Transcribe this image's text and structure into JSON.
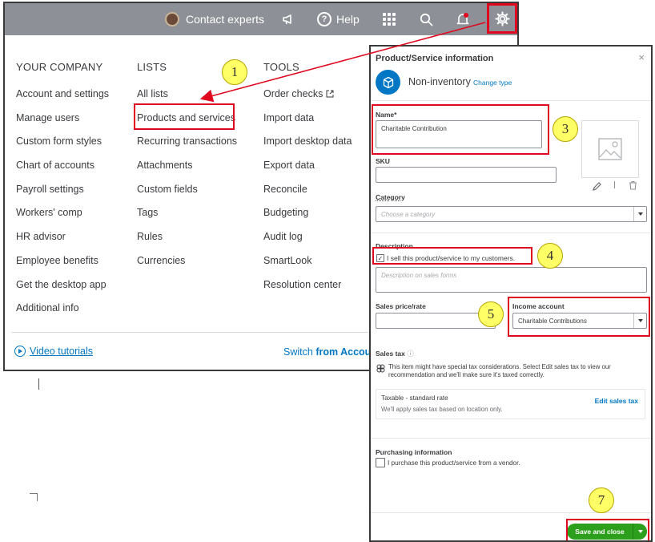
{
  "topbar": {
    "contact_label": "Contact experts",
    "help_label": "Help"
  },
  "menu": {
    "your_company": {
      "heading": "YOUR COMPANY",
      "items": [
        "Account and settings",
        "Manage users",
        "Custom form styles",
        "Chart of accounts",
        "Payroll settings",
        "Workers' comp",
        "HR advisor",
        "Employee benefits",
        "Get the desktop app",
        "Additional info"
      ]
    },
    "lists": {
      "heading": "LISTS",
      "items": [
        "All lists",
        "Products and services",
        "Recurring transactions",
        "Attachments",
        "Custom fields",
        "Tags",
        "Rules",
        "Currencies"
      ]
    },
    "tools": {
      "heading": "TOOLS",
      "items": [
        "Order checks",
        "Import data",
        "Import desktop data",
        "Export data",
        "Reconcile",
        "Budgeting",
        "Audit log",
        "SmartLook",
        "Resolution center"
      ]
    },
    "video_tutorials": "Video tutorials",
    "switch_prefix": "Switch",
    "switch_bold": "from Accoun"
  },
  "panel": {
    "title": "Product/Service information",
    "close": "×",
    "type_label": "Non-inventory",
    "change_type": "Change type",
    "name_label": "Name*",
    "name_value": "Charitable Contribution",
    "sku_label": "SKU",
    "category_label": "Category",
    "category_placeholder": "Choose a category",
    "description_label": "Description",
    "sell_checkbox_label": "I sell this product/service to my customers.",
    "description_placeholder": "Description on sales forms",
    "sales_price_label": "Sales price/rate",
    "income_account_label": "Income account",
    "income_account_value": "Charitable Contributions",
    "sales_tax_label": "Sales tax",
    "tax_notice": "This item might have special tax considerations. Select Edit sales tax to view our recommendation and we'll make sure it's taxed correctly.",
    "tax_rate_title": "Taxable - standard rate",
    "tax_rate_desc": "We'll apply sales tax based on location only.",
    "edit_sales_tax": "Edit sales tax",
    "purchasing_label": "Purchasing information",
    "purchase_checkbox_label": "I purchase this product/service from a vendor.",
    "save_button": "Save and close"
  },
  "annotations": [
    "1",
    "3",
    "4",
    "5",
    "7"
  ],
  "colors": {
    "highlight": "#e0081f",
    "brand_blue": "#0077c5",
    "save_green": "#2ca01c",
    "topbar": "#8d9096",
    "badge": "#ffff66"
  }
}
